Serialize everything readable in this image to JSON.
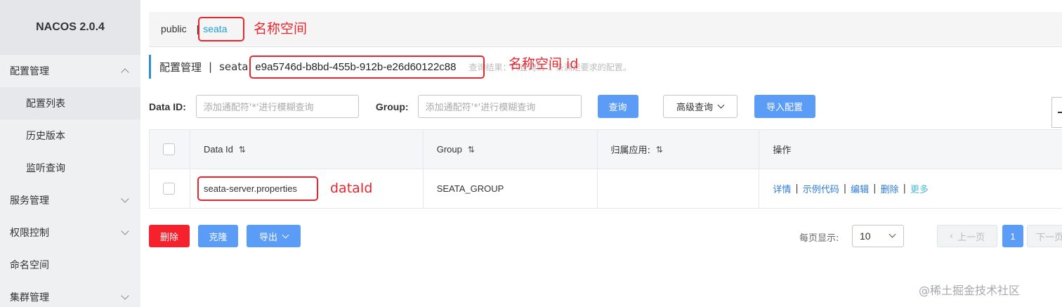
{
  "sidebar": {
    "brand": "NACOS 2.0.4",
    "items": [
      {
        "label": "配置管理",
        "expanded": true
      },
      {
        "label": "配置列表"
      },
      {
        "label": "历史版本"
      },
      {
        "label": "监听查询"
      },
      {
        "label": "服务管理",
        "expanded": false
      },
      {
        "label": "权限控制",
        "expanded": false
      },
      {
        "label": "命名空间"
      },
      {
        "label": "集群管理",
        "expanded": false
      }
    ]
  },
  "namespace_bar": {
    "public": "public",
    "separator": "|",
    "current": "seata"
  },
  "title": {
    "text": "配置管理",
    "separator": "|",
    "namespace_name": "seata",
    "namespace_id": "e9a5746d-b8bd-455b-912b-e26d60122c88",
    "hint": "查询结果：共查询到 1 条满足要求的配置。"
  },
  "filters": {
    "data_id_label": "Data ID:",
    "data_id_placeholder": "添加通配符'*'进行模糊查询",
    "group_label": "Group:",
    "group_placeholder": "添加通配符'*'进行模糊查询",
    "query_button": "查询",
    "advanced_query": "高级查询",
    "import_button": "导入配置"
  },
  "table": {
    "headers": [
      "Data Id",
      "Group",
      "归属应用:",
      "操作"
    ],
    "sort_icon": "⇅",
    "rows": [
      {
        "data_id": "seata-server.properties",
        "group": "SEATA_GROUP",
        "app": "",
        "ops": {
          "detail": "详情",
          "sample": "示例代码",
          "edit": "编辑",
          "delete": "删除",
          "more": "更多"
        }
      }
    ]
  },
  "bottom": {
    "delete_button": "删除",
    "clone_button": "克隆",
    "export_button": "导出",
    "page_size_label": "每页显示:",
    "page_size": "10",
    "prev": "上一页",
    "current_page": "1",
    "next": "下一页"
  },
  "annotations": {
    "namespace": "名称空间",
    "namespace_id": "名称空间 id",
    "data_id": "dataId"
  },
  "watermark": "@稀土掘金技术社区",
  "colors": {
    "primary": "#5b9cf6",
    "danger": "#f5222d",
    "annotation": "#e8262d",
    "link": "#2b7bd9"
  }
}
